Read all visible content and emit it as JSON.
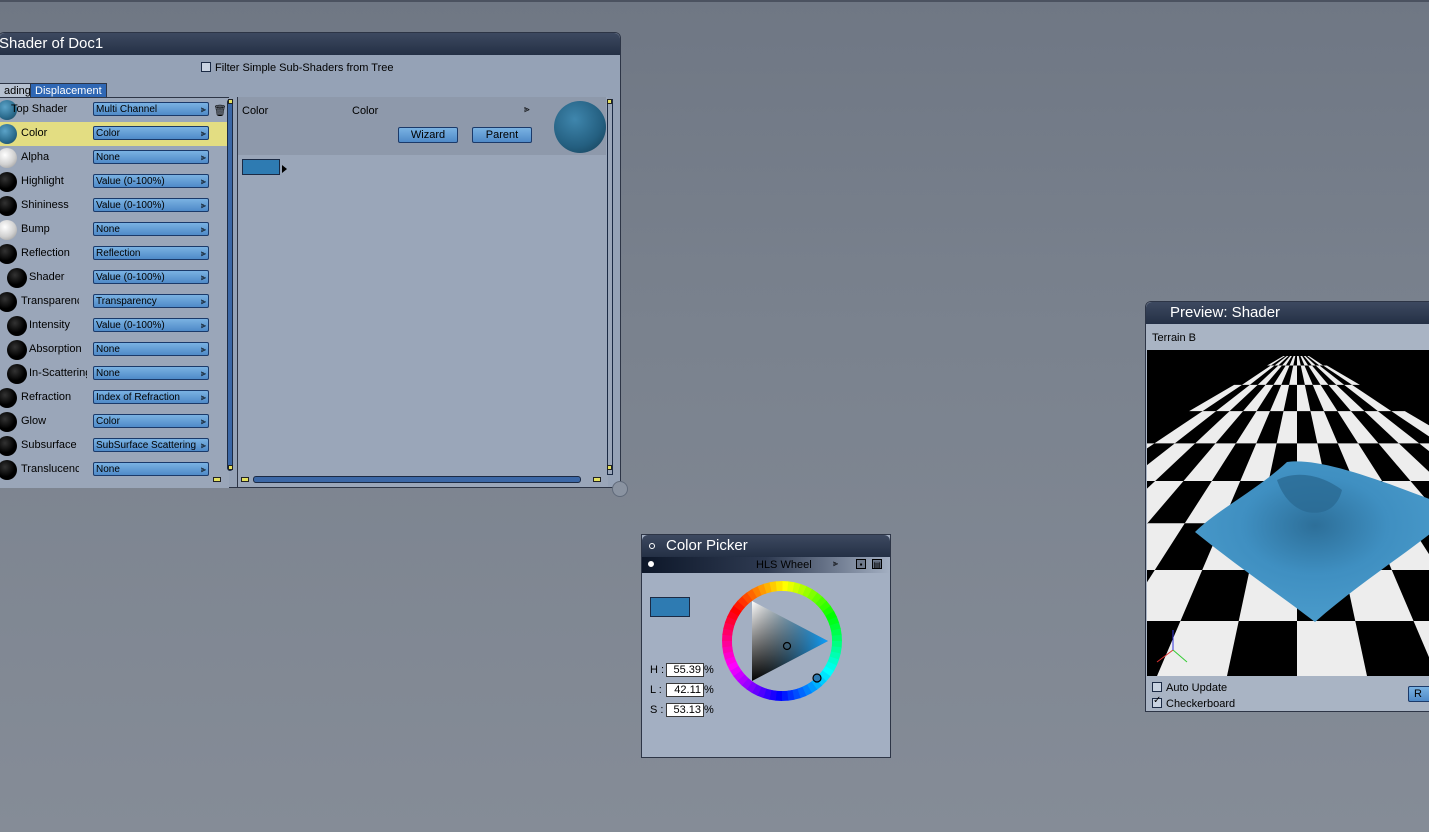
{
  "shader_window": {
    "title": "Shader of Doc1",
    "filter_label": "Filter Simple Sub-Shaders from Tree",
    "tabs": [
      {
        "label": "ading"
      },
      {
        "label": "Displacement"
      }
    ],
    "rows": [
      {
        "name": "Top Shader",
        "value": "Multi Channel"
      },
      {
        "name": "Color",
        "value": "Color"
      },
      {
        "name": "Alpha",
        "value": "None"
      },
      {
        "name": "Highlight",
        "value": "Value (0-100%)"
      },
      {
        "name": "Shininess",
        "value": "Value (0-100%)"
      },
      {
        "name": "Bump",
        "value": "None"
      },
      {
        "name": "Reflection",
        "value": "Reflection"
      },
      {
        "name": "Shader",
        "value": "Value (0-100%)"
      },
      {
        "name": "Transparency",
        "value": "Transparency"
      },
      {
        "name": "Intensity",
        "value": "Value (0-100%)"
      },
      {
        "name": "Absorption",
        "value": "None"
      },
      {
        "name": "In-Scattering",
        "value": "None"
      },
      {
        "name": "Refraction",
        "value": "Index of Refraction"
      },
      {
        "name": "Glow",
        "value": "Color"
      },
      {
        "name": "Subsurface S",
        "value": "SubSurface Scattering"
      },
      {
        "name": "Translucency",
        "value": "None"
      }
    ],
    "detail": {
      "channel_label": "Color",
      "type_label": "Color",
      "wizard_label": "Wizard",
      "parent_label": "Parent",
      "swatch_color": "#2e7bb2"
    }
  },
  "color_picker": {
    "title": "Color Picker",
    "mode": "HLS Wheel",
    "swatch_color": "#2e7bb2",
    "h_label": "H :",
    "h_value": "55.39",
    "l_label": "L :",
    "l_value": "42.11",
    "s_label": "S :",
    "s_value": "53.13",
    "unit": "%"
  },
  "preview": {
    "title": "Preview: Shader",
    "object_label": "Terrain B",
    "auto_update_label": "Auto Update",
    "auto_update_checked": false,
    "checkerboard_label": "Checkerboard",
    "checkerboard_checked": true,
    "button_label": "R"
  },
  "colors": {
    "accent_blue": "#4f8ac8",
    "selected_row": "#e3dd82",
    "terrain": "#3f8fc1"
  }
}
